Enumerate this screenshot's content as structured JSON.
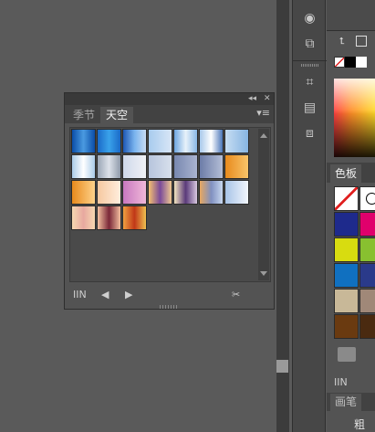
{
  "float_panel": {
    "controls": {
      "collapse": "◂◂",
      "close": "✕"
    },
    "tabs": [
      {
        "label": "季节"
      },
      {
        "label": "天空"
      }
    ],
    "menu": "▾≡",
    "bottom": {
      "library": "IIN",
      "prev": "◀",
      "next": "▶",
      "tool": "✂"
    }
  },
  "swatches": [
    "linear-gradient(90deg,#0a4da8,#4a9ae0,#0a4da8)",
    "linear-gradient(90deg,#1a6ac8,#3aa2ea,#1a6ac8)",
    "linear-gradient(90deg,#1e58b4,#7ab4ee,#c8dcf4)",
    "linear-gradient(90deg,#a8cbee,#d8e6f6)",
    "linear-gradient(90deg,#6ea6e0,#e8f2fa,#8ab8e6)",
    "linear-gradient(90deg,#a8c8ea,#ffffff,#4a76b8)",
    "linear-gradient(90deg,#c6ddf2,#86b4e2)",
    "linear-gradient(90deg,#aacbe8,#ffffff,#aacbe8)",
    "linear-gradient(90deg,#9aa6b6,#dde2ea,#8f9aaa)",
    "linear-gradient(90deg,#cfd8ea,#f0f2f6)",
    "linear-gradient(90deg,#b6c4dc,#d8e0ec)",
    "linear-gradient(90deg,#7888b0,#aab4d0)",
    "linear-gradient(90deg,#6c7ca8,#b4bed6)",
    "linear-gradient(90deg,#e88a1c,#f8c46a)",
    "linear-gradient(90deg,#e88a1c,#ffd28a)",
    "linear-gradient(90deg,#f6c8a0,#ffeedd)",
    "linear-gradient(90deg,#c878c0,#f0b8d8)",
    "linear-gradient(90deg,#f4c070,#7a4a9a,#f0c890)",
    "linear-gradient(90deg,#f2e4c0,#5a3a7a,#d8c8e0)",
    "linear-gradient(90deg,#e8a860,#8090c0,#c8d8f0)",
    "linear-gradient(90deg,#a8c4e8,#f2f6fc)",
    "linear-gradient(90deg,#f6d8b0,#e8a8a0,#f6d8b0)",
    "linear-gradient(90deg,#f4c0a0,#7a2838,#f4c0a0)",
    "linear-gradient(90deg,#f0a040,#c03818,#f0c050)"
  ],
  "right_panel": {
    "swatches_tab": "色板",
    "brush_tab": "画笔",
    "bottom_label": "粗细",
    "color_swatches": [
      "#1e2a8c",
      "#e0006c",
      "#d8dc10",
      "#88c030",
      "#1070c0",
      "#2a3a8a",
      "#c8b898",
      "#a08878",
      "#6a3a10",
      "#4a2a10"
    ]
  }
}
